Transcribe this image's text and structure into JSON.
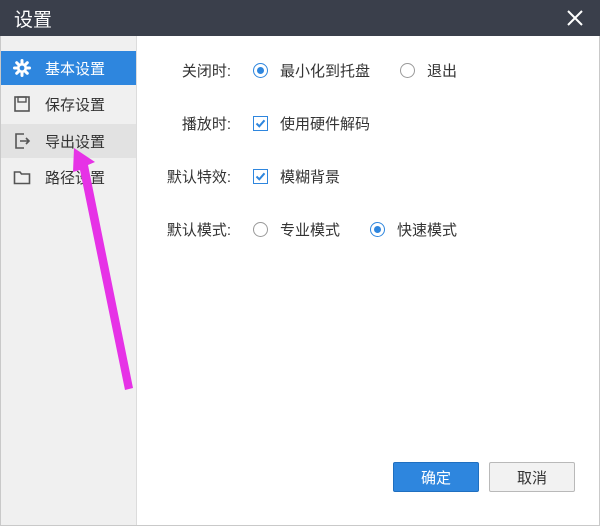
{
  "window": {
    "title": "设置",
    "close_icon": "close-icon"
  },
  "sidebar": {
    "items": [
      {
        "label": "基本设置",
        "icon": "gear-icon",
        "state": "selected"
      },
      {
        "label": "保存设置",
        "icon": "save-icon",
        "state": "normal"
      },
      {
        "label": "导出设置",
        "icon": "export-icon",
        "state": "hover"
      },
      {
        "label": "路径设置",
        "icon": "folder-icon",
        "state": "normal"
      }
    ]
  },
  "settings": {
    "close_behavior": {
      "label": "关闭时:",
      "options": [
        {
          "text": "最小化到托盘",
          "selected": true
        },
        {
          "text": "退出",
          "selected": false
        }
      ]
    },
    "playback": {
      "label": "播放时:",
      "option": "使用硬件解码",
      "checked": true
    },
    "effects": {
      "label": "默认特效:",
      "option": "模糊背景",
      "checked": true
    },
    "mode": {
      "label": "默认模式:",
      "options": [
        {
          "text": "专业模式",
          "selected": false
        },
        {
          "text": "快速模式",
          "selected": true
        }
      ]
    }
  },
  "buttons": {
    "confirm": "确定",
    "cancel": "取消"
  },
  "colors": {
    "titlebar": "#3a3f4b",
    "accent": "#2e86de",
    "sidebar": "#f0f0f0",
    "annotation_arrow": "#e632e6"
  }
}
